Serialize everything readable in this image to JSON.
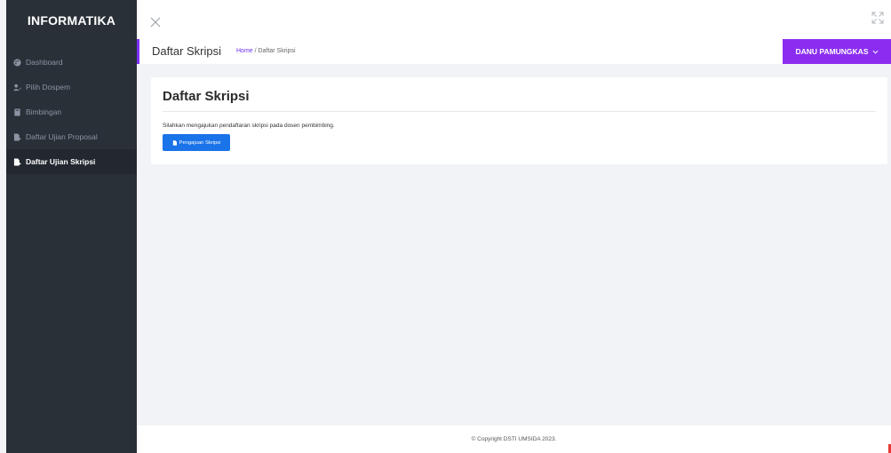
{
  "sidebar": {
    "brand": "INFORMATIKA",
    "items": [
      {
        "label": "Dashboard",
        "icon": "palette-icon",
        "active": false
      },
      {
        "label": "Pilih Dospem",
        "icon": "user-edit-icon",
        "active": false
      },
      {
        "label": "Bimbingan",
        "icon": "book-icon",
        "active": false
      },
      {
        "label": "Daftar Ujian Proposal",
        "icon": "file-arrow-icon",
        "active": false
      },
      {
        "label": "Daftar Ujian Skripsi",
        "icon": "file-arrow-icon",
        "active": true
      }
    ]
  },
  "header": {
    "page_title": "Daftar Skripsi",
    "breadcrumb_home": "Home",
    "breadcrumb_sep": "/",
    "breadcrumb_current": "Daftar Skripsi",
    "user_name": "DANU PAMUNGKAS"
  },
  "card": {
    "title": "Daftar Skripsi",
    "text": "Silahkan mengajukan pendaftaran skripsi pada dosen pembimbing.",
    "button_label": "Pengajuan Skripsi"
  },
  "footer": {
    "copyright": "© Copyright DSTI UMSIDA 2023."
  },
  "colors": {
    "sidebar_bg": "#2a3038",
    "accent": "#8b2df0",
    "primary_button": "#1a73e8",
    "link": "#6f2ff5"
  }
}
